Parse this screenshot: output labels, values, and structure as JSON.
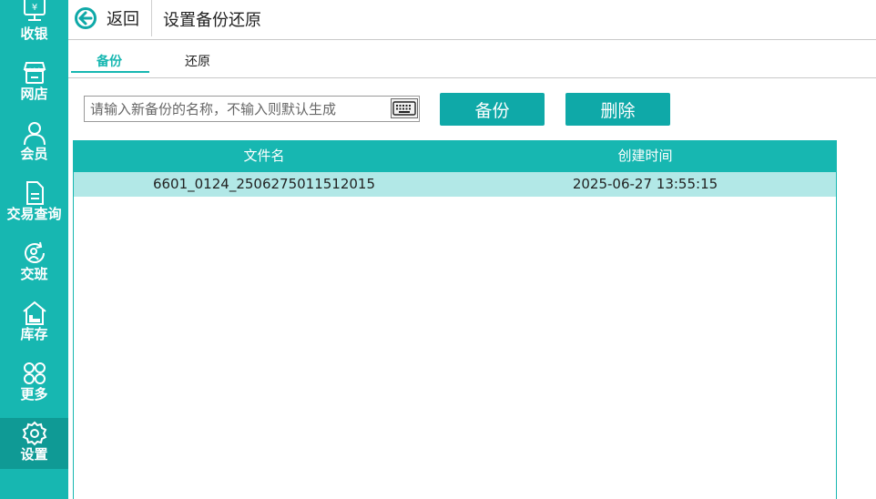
{
  "sidebar": {
    "items": [
      {
        "label": "收银",
        "icon": "cashier-icon"
      },
      {
        "label": "网店",
        "icon": "store-icon"
      },
      {
        "label": "会员",
        "icon": "member-icon"
      },
      {
        "label": "交易查询",
        "icon": "document-icon"
      },
      {
        "label": "交班",
        "icon": "shift-icon"
      },
      {
        "label": "库存",
        "icon": "warehouse-icon"
      },
      {
        "label": "更多",
        "icon": "more-icon"
      },
      {
        "label": "设置",
        "icon": "gear-icon"
      }
    ],
    "active_index": 7
  },
  "header": {
    "back_label": "返回",
    "title": "设置备份还原"
  },
  "tabs": [
    {
      "label": "备份",
      "active": true
    },
    {
      "label": "还原",
      "active": false
    }
  ],
  "backup": {
    "name_placeholder": "请输入新备份的名称，不输入则默认生成",
    "name_value": "",
    "backup_button": "备份",
    "delete_button": "删除"
  },
  "table": {
    "columns": [
      "文件名",
      "创建时间"
    ],
    "rows": [
      {
        "file_name": "6601_0124_2506275011512015",
        "created_at": "2025-06-27 13:55:15",
        "selected": true
      }
    ]
  },
  "colors": {
    "accent": "#17b7b1",
    "button": "#0fa9a8",
    "selected_row": "#b2e8e7"
  }
}
